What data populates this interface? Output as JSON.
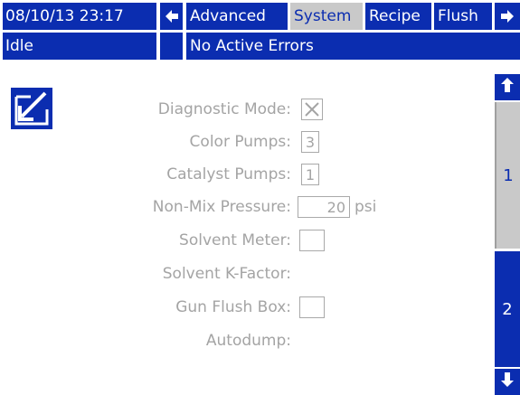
{
  "header": {
    "datetime": "08/10/13 23:17",
    "tabs": [
      "Advanced",
      "System",
      "Recipe",
      "Flush"
    ],
    "active_tab": "System"
  },
  "status": {
    "state": "Idle",
    "errors": "No Active Errors"
  },
  "form": {
    "diagnostic_mode": {
      "label": "Diagnostic Mode:",
      "checked": true
    },
    "color_pumps": {
      "label": "Color Pumps:",
      "value": "3"
    },
    "catalyst_pumps": {
      "label": "Catalyst Pumps:",
      "value": "1"
    },
    "non_mix_pressure": {
      "label": "Non-Mix Pressure:",
      "value": "20",
      "unit": "psi"
    },
    "solvent_meter": {
      "label": "Solvent Meter:",
      "checked": false
    },
    "solvent_k_factor": {
      "label": "Solvent K-Factor:"
    },
    "gun_flush_box": {
      "label": "Gun Flush Box:",
      "checked": false
    },
    "autodump": {
      "label": "Autodump:"
    }
  },
  "pages": {
    "current": "1",
    "next": "2"
  },
  "icons": {
    "edit": "edit-mode-icon",
    "prev_tab": "arrow-left-icon",
    "next_tab": "arrow-right-icon",
    "page_up": "arrow-up-icon",
    "page_down": "arrow-down-icon"
  },
  "colors": {
    "accent": "#0b2db0",
    "selected": "#c9c9c9",
    "disabled_text": "#a4a4a4"
  }
}
